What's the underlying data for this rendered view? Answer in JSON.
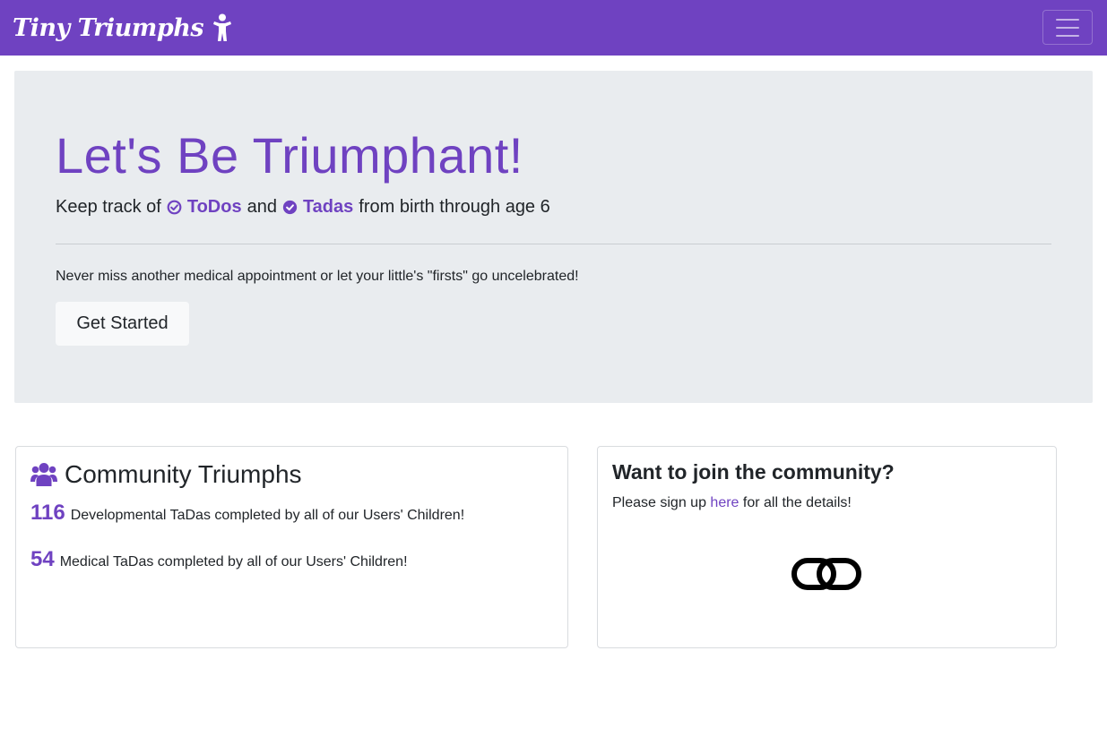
{
  "navbar": {
    "brand": "Tiny Triumphs",
    "brand_icon": "child-icon",
    "toggler_icon": "hamburger-icon",
    "bg_color": "#6f42c1"
  },
  "hero": {
    "title": "Let's Be Triumphant!",
    "lead_prefix": "Keep track of",
    "todos_label": "ToDos",
    "lead_and": "and",
    "tadas_label": "Tadas",
    "lead_suffix": "from birth through age 6",
    "paragraph": "Never miss another medical appointment or let your little's \"firsts\" go uncelebrated!",
    "button_label": "Get Started",
    "accent_color": "#6f42c1"
  },
  "community": {
    "title": "Community Triumphs",
    "icon": "users-icon",
    "stats": [
      {
        "value": "116",
        "label": "Developmental TaDas completed by all of our Users' Children!"
      },
      {
        "value": "54",
        "label": "Medical TaDas completed by all of our Users' Children!"
      }
    ]
  },
  "join": {
    "title": "Want to join the community?",
    "text_prefix": "Please sign up",
    "link_label": "here",
    "text_suffix": "for all the details!",
    "icon": "link-icon"
  }
}
